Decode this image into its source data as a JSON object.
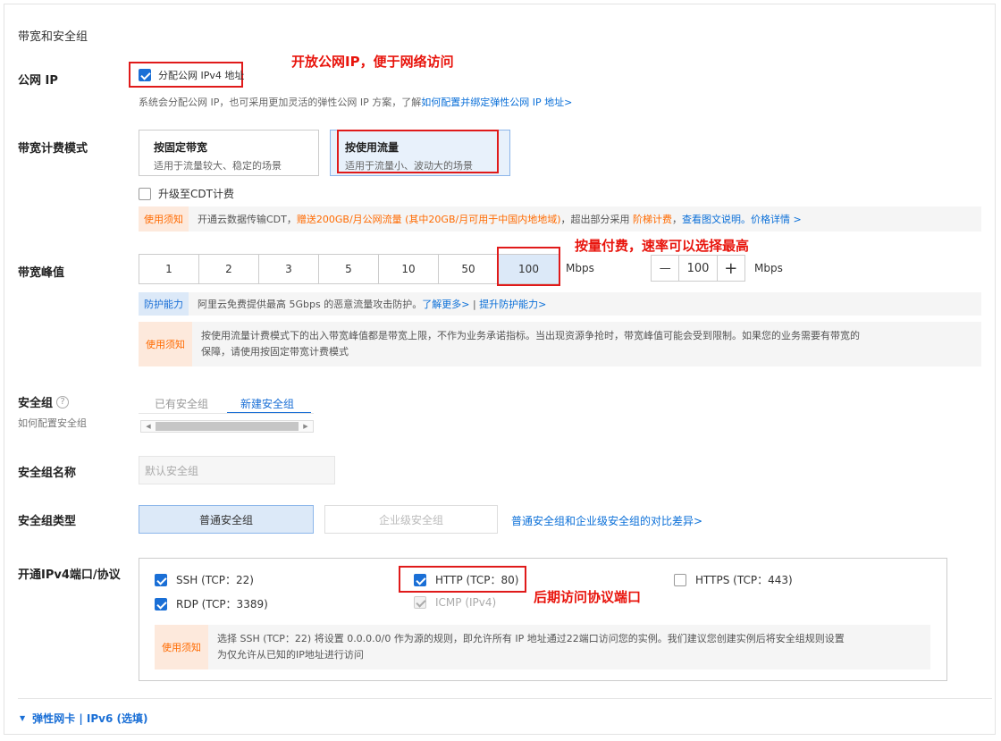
{
  "section_title": "带宽和安全组",
  "public_ip": {
    "label": "公网 IP",
    "checkbox_label": "分配公网 IPv4 地址",
    "hint": "系统会分配公网 IP，也可采用更加灵活的弹性公网 IP 方案，了解",
    "hint_link": "如何配置并绑定弹性公网 IP 地址>",
    "annotation": "开放公网IP，便于网络访问"
  },
  "billing": {
    "label": "带宽计费模式",
    "options": [
      {
        "title": "按固定带宽",
        "desc": "适用于流量较大、稳定的场景"
      },
      {
        "title": "按使用流量",
        "desc": "适用于流量小、波动大的场景"
      }
    ],
    "cdt_label": "升级至CDT计费",
    "notice_tag": "使用须知",
    "notice_text1": "开通云数据传输CDT，",
    "notice_text2": "赠送200GB/月公网流量 (其中20GB/月可用于中国内地地域)",
    "notice_text3": "，超出部分采用",
    "notice_text4": "阶梯计费",
    "notice_text5": "，",
    "notice_link1": "查看图文说明。",
    "notice_link2": "价格详情 >"
  },
  "bandwidth": {
    "label": "带宽峰值",
    "annotation": "按量付费，速率可以选择最高",
    "options": [
      "1",
      "2",
      "3",
      "5",
      "10",
      "50",
      "100"
    ],
    "unit": "Mbps",
    "stepper_minus": "—",
    "stepper_value": "100",
    "stepper_plus": "+",
    "stepper_unit": "Mbps",
    "protect_tag": "防护能力",
    "protect_text": "阿里云免费提供最高 5Gbps 的恶意流量攻击防护。",
    "protect_link1": "了解更多>",
    "protect_sep": "|",
    "protect_link2": "提升防护能力>",
    "notice_tag": "使用须知",
    "notice_line1": "按使用流量计费模式下的出入带宽峰值都是带宽上限，不作为业务承诺指标。当出现资源争抢时，带宽峰值可能会受到限制。如果您的业务需要有带宽的",
    "notice_line2": "保障，请使用按固定带宽计费模式"
  },
  "security_group": {
    "label": "安全组",
    "help_icon": "?",
    "sub_label": "如何配置安全组",
    "tabs": [
      "已有安全组",
      "新建安全组"
    ],
    "scroll_left": "◀",
    "scroll_right": "▶"
  },
  "sg_name": {
    "label": "安全组名称",
    "placeholder": "默认安全组"
  },
  "sg_type": {
    "label": "安全组类型",
    "options": [
      "普通安全组",
      "企业级安全组"
    ],
    "compare_link": "普通安全组和企业级安全组的对比差异>"
  },
  "ports": {
    "label": "开通IPv4端口/协议",
    "items": [
      {
        "label": "SSH (TCP：22)"
      },
      {
        "label": "HTTP (TCP：80)"
      },
      {
        "label": "HTTPS (TCP：443)"
      },
      {
        "label": "RDP (TCP：3389)"
      },
      {
        "label": "ICMP (IPv4)"
      }
    ],
    "annotation": "后期访问协议端口",
    "notice_tag": "使用须知",
    "notice_line1": "选择 SSH (TCP：22) 将设置 0.0.0.0/0 作为源的规则，即允许所有 IP 地址通过22端口访问您的实例。我们建议您创建实例后将安全组规则设置",
    "notice_line2": "为仅允许从已知的IP地址进行访问"
  },
  "footer": {
    "arrow": "▼",
    "label": "弹性网卡 | IPv6 (选填)"
  }
}
